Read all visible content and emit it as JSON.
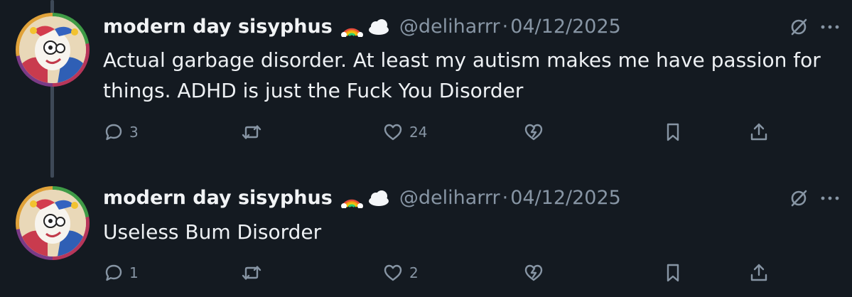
{
  "posts": [
    {
      "display_name": "modern day sisyphus",
      "handle": "@deliharrr",
      "separator": "·",
      "timestamp": "04/12/2025",
      "text": "Actual garbage disorder. At least my autism makes me have passion for things. ADHD is just the Fuck You Disorder",
      "replies": "3",
      "reposts": "",
      "likes": "24",
      "icons": [
        "rainbow-emoji",
        "cloud-emoji",
        "translate-icon",
        "more-icon",
        "reply-icon",
        "repost-icon",
        "like-icon",
        "quote-icon",
        "bookmark-icon",
        "share-icon"
      ]
    },
    {
      "display_name": "modern day sisyphus",
      "handle": "@deliharrr",
      "separator": "·",
      "timestamp": "04/12/2025",
      "text": "Useless Bum Disorder",
      "replies": "1",
      "reposts": "",
      "likes": "2",
      "icons": [
        "rainbow-emoji",
        "cloud-emoji",
        "translate-icon",
        "more-icon",
        "reply-icon",
        "repost-icon",
        "like-icon",
        "quote-icon",
        "bookmark-icon",
        "share-icon"
      ]
    }
  ],
  "colors": {
    "background": "#141a21",
    "muted": "#8795a4",
    "text": "#eef1f4",
    "thread_line": "#3e4957"
  }
}
